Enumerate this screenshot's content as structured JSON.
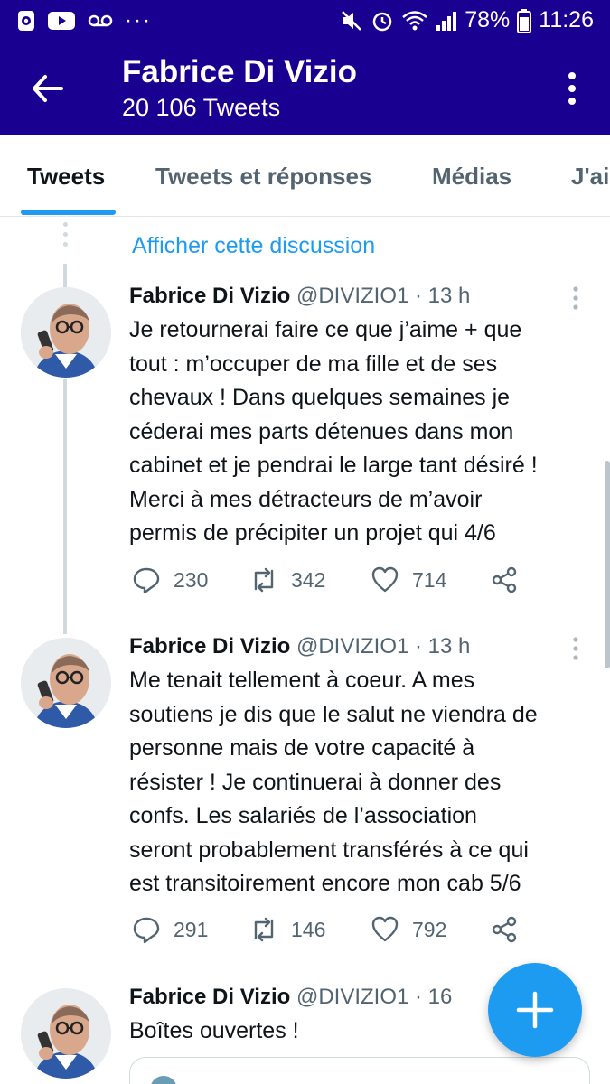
{
  "status_bar": {
    "battery": "78%",
    "time": "11:26",
    "dots": "···",
    "left_icons": [
      "sync-icon",
      "youtube-icon",
      "voicemail-icon"
    ],
    "right_icons": [
      "mute-icon",
      "alarm-icon",
      "wifi-icon",
      "signal-icon",
      "battery-icon"
    ]
  },
  "header": {
    "title": "Fabrice Di Vizio",
    "subtitle": "20 106 Tweets"
  },
  "tabs": [
    {
      "label": "Tweets",
      "active": true
    },
    {
      "label": "Tweets et réponses",
      "active": false
    },
    {
      "label": "Médias",
      "active": false
    },
    {
      "label": "J'ai",
      "active": false
    }
  ],
  "show_thread": "Afficher cette discussion",
  "tweets": [
    {
      "name": "Fabrice Di Vizio",
      "meta": " @DIVIZIO1 · 13 h",
      "text": "Je retournerai faire ce que j’aime + que\ntout : m’occuper de ma fille et de ses\nchevaux ! Dans quelques semaines je\ncéderai mes parts détenues dans mon\ncabinet et je pendrai le large tant désiré !\nMerci à mes détracteurs de m’avoir\npermis de précipiter un projet qui 4/6",
      "replies": "230",
      "retweets": "342",
      "likes": "714"
    },
    {
      "name": "Fabrice Di Vizio",
      "meta": " @DIVIZIO1 · 13 h",
      "text": "Me tenait tellement à coeur. A mes\nsoutiens je dis que le salut ne viendra de\npersonne mais de votre capacité à\nrésister ! Je continuerai à donner des\nconfs. Les salariés de l’association\nseront probablement transférés à ce qui\nest transitoirement encore  mon cab 5/6",
      "replies": "291",
      "retweets": "146",
      "likes": "792"
    },
    {
      "name": "Fabrice Di Vizio",
      "meta": " @DIVIZIO1 · 16",
      "text": "Boîtes ouvertes !"
    }
  ],
  "colors": {
    "header_bg": "#1a0091",
    "accent": "#1d9bf0",
    "secondary_text": "#536471"
  }
}
